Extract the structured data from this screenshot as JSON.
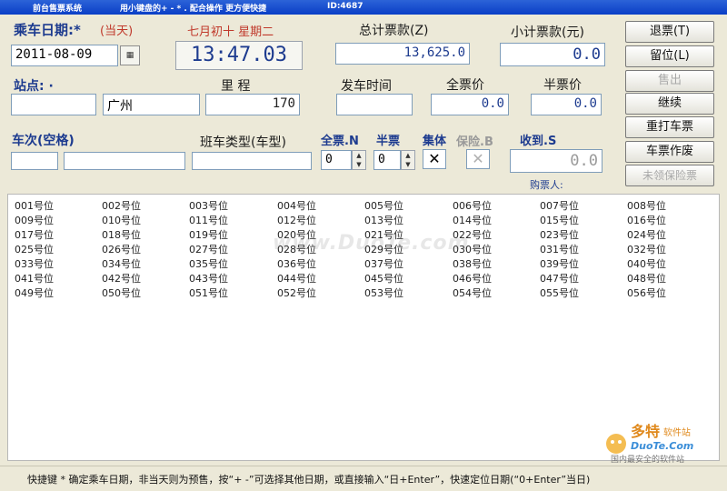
{
  "titlebar": {
    "app_title": "前台售票系统",
    "hint": "用小键盘的+ - * . 配合操作 更方便快捷",
    "id_label": "ID:4687"
  },
  "date_section": {
    "label": "乘车日期:*",
    "today_label": "(当天)",
    "date_value": "2011-08-09",
    "lunar": "七月初十  星期二",
    "clock": "13:47.03"
  },
  "totals": {
    "total_label": "总计票款(Z)",
    "total_value": "13,625.0",
    "subtotal_label": "小计票款(元)",
    "subtotal_value": "0.0"
  },
  "station": {
    "label": "站点: ·",
    "code_value": "",
    "name_value": "广州",
    "mileage_label": "里 程",
    "mileage_value": "170",
    "departure_label": "发车时间",
    "departure_value": "",
    "full_price_label": "全票价",
    "full_price_value": "0.0",
    "half_price_label": "半票价",
    "half_price_value": "0.0"
  },
  "trip": {
    "label": "车次(空格)",
    "code_value": "",
    "name_value": "",
    "bus_type_label": "班车类型(车型)",
    "bus_type_value": "",
    "full_ticket_label": "全票.N",
    "full_ticket_value": "0",
    "half_ticket_label": "半票",
    "half_ticket_value": "0",
    "group_label": "集体",
    "insurance_label": "保险.B",
    "received_label": "收到.S",
    "received_value": "0.0",
    "buyer_label": "购票人:"
  },
  "side_buttons": [
    {
      "label": "退票(T)",
      "enabled": true
    },
    {
      "label": "留位(L)",
      "enabled": true
    },
    {
      "label": "售出",
      "enabled": false
    },
    {
      "label": "继续",
      "enabled": true
    },
    {
      "label": "重打车票",
      "enabled": true
    },
    {
      "label": "车票作废",
      "enabled": true
    },
    {
      "label": "未领保险票",
      "enabled": false
    }
  ],
  "seats": [
    "001号位",
    "002号位",
    "003号位",
    "004号位",
    "005号位",
    "006号位",
    "007号位",
    "008号位",
    "009号位",
    "010号位",
    "011号位",
    "012号位",
    "013号位",
    "014号位",
    "015号位",
    "016号位",
    "017号位",
    "018号位",
    "019号位",
    "020号位",
    "021号位",
    "022号位",
    "023号位",
    "024号位",
    "025号位",
    "026号位",
    "027号位",
    "028号位",
    "029号位",
    "030号位",
    "031号位",
    "032号位",
    "033号位",
    "034号位",
    "035号位",
    "036号位",
    "037号位",
    "038号位",
    "039号位",
    "040号位",
    "041号位",
    "042号位",
    "043号位",
    "044号位",
    "045号位",
    "046号位",
    "047号位",
    "048号位",
    "049号位",
    "050号位",
    "051号位",
    "052号位",
    "053号位",
    "054号位",
    "055号位",
    "056号位"
  ],
  "status": {
    "text": "快捷键 *  确定乘车日期，非当天则为预售，按“+ -”可选择其他日期，或直接输入“日+Enter”，快速定位日期(“0+Enter”当日)"
  },
  "watermark": "www.DuoTe.com",
  "icons": {
    "calendar": "calendar-icon",
    "spin_up": "spin-up-icon",
    "spin_down": "spin-down-icon"
  }
}
